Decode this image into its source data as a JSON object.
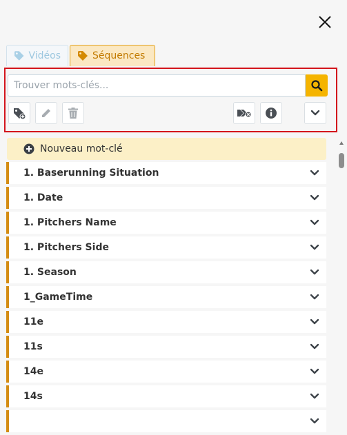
{
  "tabs": [
    {
      "label": "Vidéos",
      "icon": "tag-icon",
      "active": false
    },
    {
      "label": "Séquences",
      "icon": "tag-icon",
      "active": true
    }
  ],
  "search": {
    "placeholder": "Trouver mots-clés..."
  },
  "toolbar": {
    "icons": [
      "tag-add-icon",
      "pencil-icon",
      "trash-icon",
      "tags-remove-icon",
      "info-icon",
      "chevron-down-icon"
    ]
  },
  "new_keyword": {
    "label": "Nouveau mot-clé"
  },
  "keywords": [
    "1. Baserunning Situation",
    "1. Date",
    "1. Pitchers Name",
    "1. Pitchers Side",
    "1. Season",
    "1_GameTime",
    "11e",
    "11s",
    "14e",
    "14s",
    ""
  ],
  "colors": {
    "accent": "#f5b400",
    "item_bar": "#d48c12",
    "highlight_border": "#d3141b",
    "active_tab_bg": "#fbe8c2",
    "new_keyword_bg": "#fcf0c7"
  }
}
